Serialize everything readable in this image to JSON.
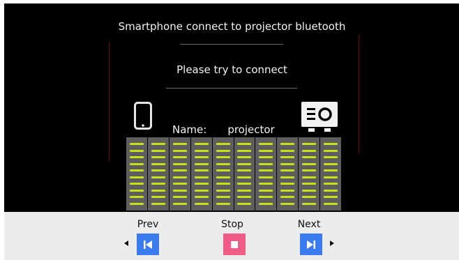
{
  "screen": {
    "title": "Smartphone connect to projector bluetooth",
    "message": "Please try to connect",
    "device": {
      "name_label": "Name:",
      "name_value": "projector"
    },
    "signal_meter": {
      "columns": 10,
      "bars_per_column": 10,
      "bar_color": "#c8e01a",
      "column_color": "#5e5e5e"
    },
    "icons": {
      "phone": "smartphone-icon",
      "projector": "projector-icon"
    }
  },
  "controls": {
    "prev_label": "Prev",
    "stop_label": "Stop",
    "next_label": "Next",
    "prev_color": "#3a7bf0",
    "stop_color": "#ef5d86",
    "next_color": "#3a7bf0"
  }
}
